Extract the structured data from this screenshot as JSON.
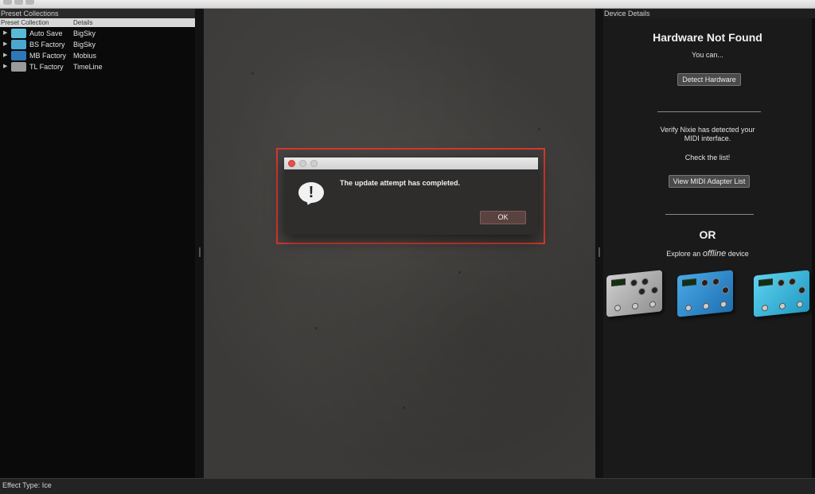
{
  "left_panel": {
    "title": "Preset Collections",
    "columns": [
      "Preset Collection",
      "Details"
    ],
    "rows": [
      {
        "name": "Auto Save",
        "details": "BigSky",
        "thumb_color": "#5ab9d6"
      },
      {
        "name": "BS Factory",
        "details": "BigSky",
        "thumb_color": "#4aa7cf"
      },
      {
        "name": "MB Factory",
        "details": "Mobius",
        "thumb_color": "#2f77b8"
      },
      {
        "name": "TL Factory",
        "details": "TimeLine",
        "thumb_color": "#9a9a9a"
      }
    ]
  },
  "dialog": {
    "message": "The update attempt has completed.",
    "ok_label": "OK",
    "icon": "alert-icon"
  },
  "right_panel": {
    "title": "Device Details",
    "heading": "Hardware Not Found",
    "you_can": "You can...",
    "detect_button": "Detect Hardware",
    "verify_line1": "Verify Nixie has detected your",
    "verify_line2": "MIDI interface.",
    "check": "Check the list!",
    "midi_button": "View MIDI Adapter List",
    "or": "OR",
    "explore_prefix": "Explore an",
    "explore_em": "offline",
    "explore_suffix": "device",
    "pedals": [
      "TimeLine pedal",
      "Mobius pedal",
      "BigSky pedal"
    ]
  },
  "status_bar": {
    "text": "Effect Type: Ice"
  },
  "colors": {
    "highlight": "#d8372d",
    "background": "#1b1b1b"
  }
}
